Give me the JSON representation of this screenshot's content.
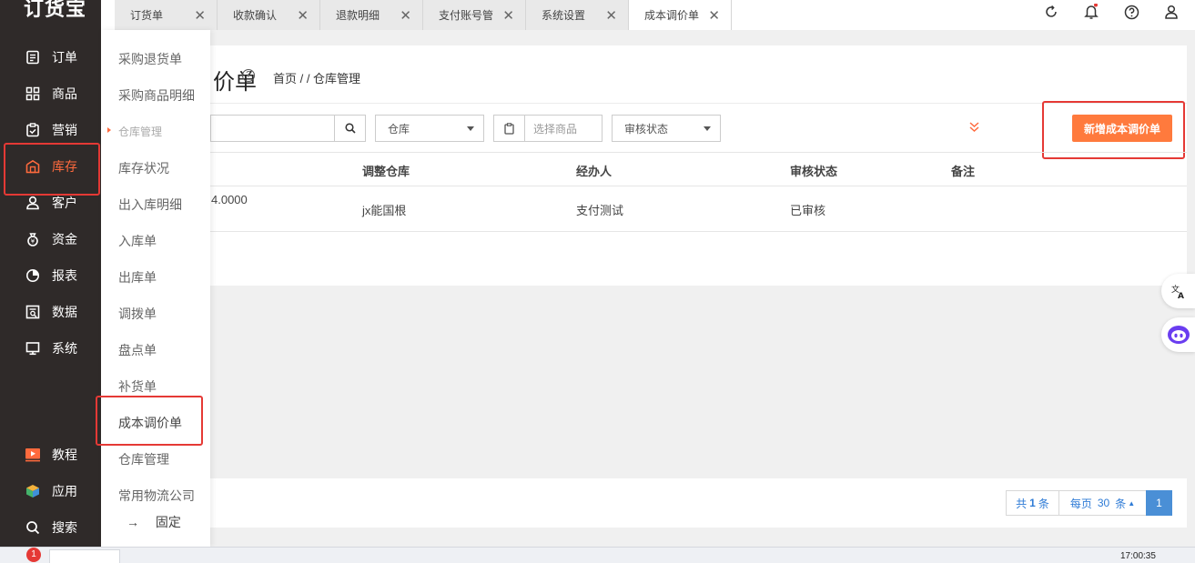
{
  "app": {
    "logo": "订货宝"
  },
  "tabs": [
    {
      "label": "订货单"
    },
    {
      "label": "收款确认"
    },
    {
      "label": "退款明细"
    },
    {
      "label": "支付账号管"
    },
    {
      "label": "系统设置"
    },
    {
      "label": "成本调价单"
    }
  ],
  "sidebar": {
    "items": [
      {
        "label": "订单",
        "icon": "order-icon"
      },
      {
        "label": "商品",
        "icon": "grid-icon"
      },
      {
        "label": "营销",
        "icon": "clipboard-icon"
      },
      {
        "label": "库存",
        "icon": "warehouse-icon"
      },
      {
        "label": "客户",
        "icon": "user-icon"
      },
      {
        "label": "资金",
        "icon": "money-bag-icon"
      },
      {
        "label": "报表",
        "icon": "pie-chart-icon"
      },
      {
        "label": "数据",
        "icon": "data-icon"
      },
      {
        "label": "系统",
        "icon": "monitor-icon"
      }
    ],
    "bottom": [
      {
        "label": "教程",
        "icon": "play-icon"
      },
      {
        "label": "应用",
        "icon": "cube-icon"
      },
      {
        "label": "搜索",
        "icon": "search-icon"
      }
    ]
  },
  "submenu": {
    "items_top": [
      "采购退货单",
      "采购商品明细"
    ],
    "group": "仓库管理",
    "items": [
      "库存状况",
      "出入库明细",
      "入库单",
      "出库单",
      "调拨单",
      "盘点单",
      "补货单",
      "成本调价单",
      "仓库管理",
      "常用物流公司"
    ],
    "pin": "固定",
    "pin_arrow": "→"
  },
  "page": {
    "title_fragment": "价单",
    "breadcrumb": "首页 / / 仓库管理"
  },
  "filters": {
    "warehouse": "仓库",
    "product_placeholder": "选择商品",
    "audit_status": "审核状态",
    "new_button": "新增成本调价单"
  },
  "table": {
    "headers": [
      "调整仓库",
      "经办人",
      "审核状态",
      "备注"
    ],
    "rows": [
      {
        "amount": "4.0000",
        "warehouse": "jx能国根",
        "handler": "支付测试",
        "status": "已审核",
        "remark": ""
      }
    ]
  },
  "pagination": {
    "total_prefix": "共",
    "total": "1",
    "total_suffix": "条",
    "per_page_prefix": "每页",
    "per_page": "30",
    "per_page_suffix": "条",
    "current_page": "1"
  },
  "colors": {
    "accent": "#ff7a3d",
    "sidebar": "#2f2a29",
    "highlight": "#e53935",
    "page_active": "#4a8fd6"
  },
  "taskbar": {
    "badge": "1",
    "clock": "17:00:35"
  }
}
